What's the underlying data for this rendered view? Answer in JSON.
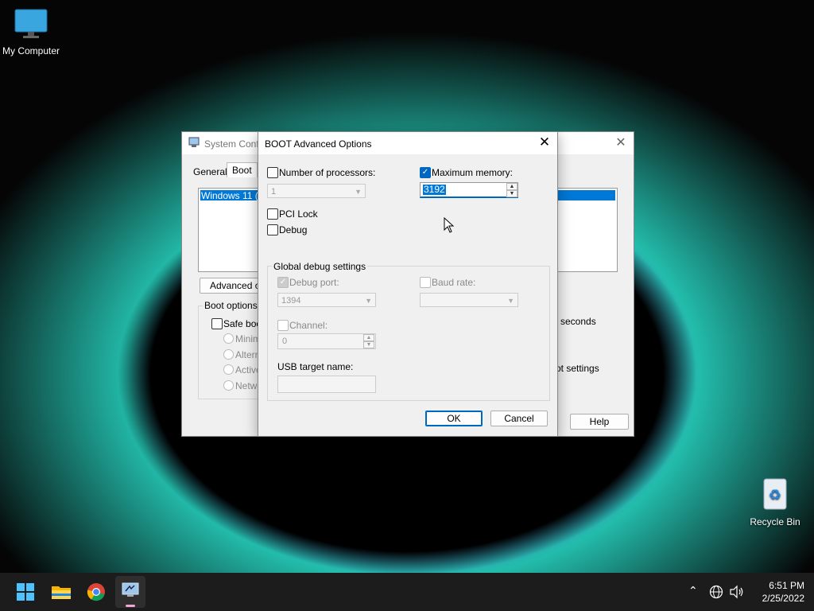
{
  "desktop": {
    "my_computer_label": "My Computer",
    "recycle_bin_label": "Recycle Bin"
  },
  "syscfg": {
    "title": "System Conf",
    "tabs": [
      "General",
      "Boot"
    ],
    "os_entry": "Windows 11 (C",
    "advanced_button": "Advanced op",
    "boot_options_label": "Boot options",
    "safe_boot_label": "Safe boo",
    "radio_labels": [
      "Minima",
      "Altern",
      "Active",
      "Netwo"
    ],
    "seconds_label": "seconds",
    "ot_settings_label": "ot settings",
    "help_button": "Help"
  },
  "boot_dialog": {
    "title": "BOOT Advanced Options",
    "num_processors_label": "Number of processors:",
    "num_processors_value": "1",
    "max_memory_label": "Maximum memory:",
    "max_memory_value": "3192",
    "pci_lock_label": "PCI Lock",
    "debug_label": "Debug",
    "global_debug_label": "Global debug settings",
    "debug_port_label": "Debug port:",
    "debug_port_value": "1394",
    "baud_rate_label": "Baud rate:",
    "baud_rate_value": "",
    "channel_label": "Channel:",
    "channel_value": "0",
    "usb_target_label": "USB target name:",
    "usb_target_value": "",
    "ok_button": "OK",
    "cancel_button": "Cancel"
  },
  "taskbar": {
    "time": "6:51 PM",
    "date": "2/25/2022"
  },
  "colors": {
    "accent": "#0078d7",
    "checkbox_checked": "#0067c0",
    "taskbar_bg": "#1c1c1c"
  }
}
